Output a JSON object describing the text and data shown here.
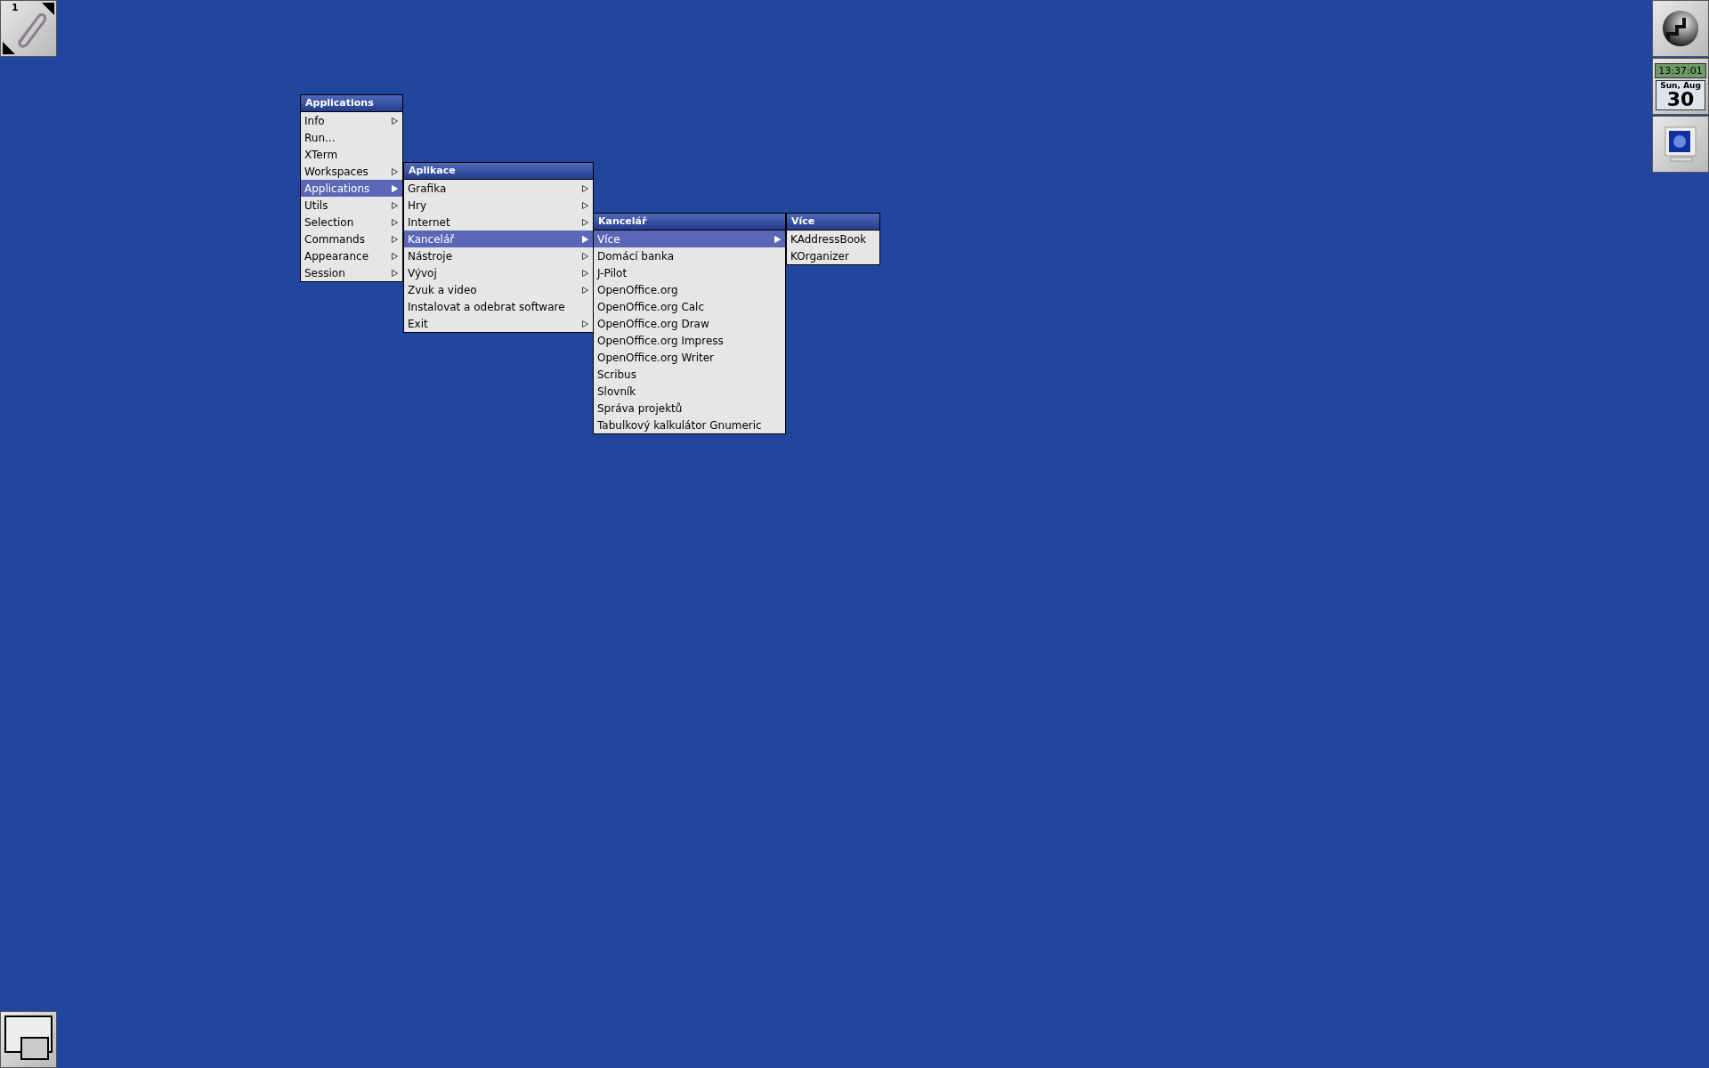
{
  "clip": {
    "workspace": "1"
  },
  "menus": [
    {
      "title": "Applications",
      "items": [
        {
          "label": "Info",
          "submenu": true,
          "selected": false
        },
        {
          "label": "Run...",
          "submenu": false,
          "selected": false
        },
        {
          "label": "XTerm",
          "submenu": false,
          "selected": false
        },
        {
          "label": "Workspaces",
          "submenu": true,
          "selected": false
        },
        {
          "label": "Applications",
          "submenu": true,
          "selected": true
        },
        {
          "label": "Utils",
          "submenu": true,
          "selected": false
        },
        {
          "label": "Selection",
          "submenu": true,
          "selected": false
        },
        {
          "label": "Commands",
          "submenu": true,
          "selected": false
        },
        {
          "label": "Appearance",
          "submenu": true,
          "selected": false
        },
        {
          "label": "Session",
          "submenu": true,
          "selected": false
        }
      ]
    },
    {
      "title": "Aplikace",
      "items": [
        {
          "label": "Grafika",
          "submenu": true,
          "selected": false
        },
        {
          "label": "Hry",
          "submenu": true,
          "selected": false
        },
        {
          "label": "Internet",
          "submenu": true,
          "selected": false
        },
        {
          "label": "Kancelář",
          "submenu": true,
          "selected": true
        },
        {
          "label": "Nástroje",
          "submenu": true,
          "selected": false
        },
        {
          "label": "Vývoj",
          "submenu": true,
          "selected": false
        },
        {
          "label": "Zvuk a video",
          "submenu": true,
          "selected": false
        },
        {
          "label": "Instalovat a odebrat software",
          "submenu": false,
          "selected": false
        },
        {
          "label": "Exit",
          "submenu": true,
          "selected": false
        }
      ]
    },
    {
      "title": "Kancelář",
      "items": [
        {
          "label": "Více",
          "submenu": true,
          "selected": true
        },
        {
          "label": "Domácí banka",
          "submenu": false,
          "selected": false
        },
        {
          "label": "J-Pilot",
          "submenu": false,
          "selected": false
        },
        {
          "label": "OpenOffice.org",
          "submenu": false,
          "selected": false
        },
        {
          "label": "OpenOffice.org Calc",
          "submenu": false,
          "selected": false
        },
        {
          "label": "OpenOffice.org Draw",
          "submenu": false,
          "selected": false
        },
        {
          "label": "OpenOffice.org Impress",
          "submenu": false,
          "selected": false
        },
        {
          "label": "OpenOffice.org Writer",
          "submenu": false,
          "selected": false
        },
        {
          "label": "Scribus",
          "submenu": false,
          "selected": false
        },
        {
          "label": "Slovník",
          "submenu": false,
          "selected": false
        },
        {
          "label": "Správa projektů",
          "submenu": false,
          "selected": false
        },
        {
          "label": "Tabulkový kalkulátor Gnumeric",
          "submenu": false,
          "selected": false
        }
      ]
    },
    {
      "title": "Více",
      "items": [
        {
          "label": "KAddressBook",
          "submenu": false,
          "selected": false
        },
        {
          "label": "KOrganizer",
          "submenu": false,
          "selected": false
        }
      ]
    }
  ],
  "dock": {
    "clock": {
      "time": "13:37:01",
      "date": "Sun, Aug",
      "day": "30"
    }
  }
}
